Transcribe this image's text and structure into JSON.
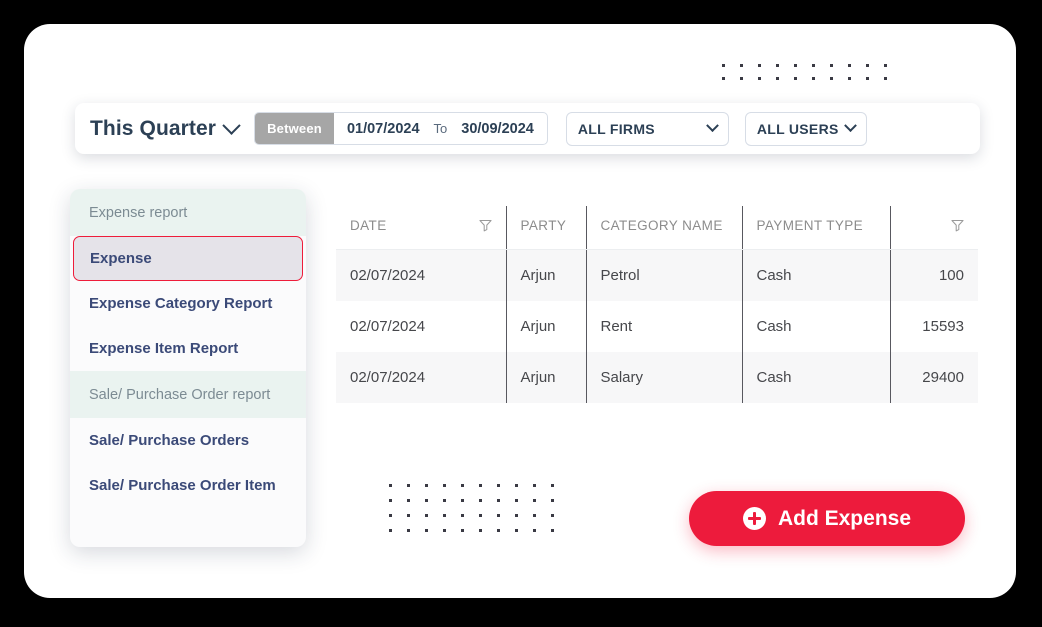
{
  "toolbar": {
    "period_label": "This Quarter",
    "between_badge": "Between",
    "date_from": "01/07/2024",
    "to_label": "To",
    "date_to": "30/09/2024",
    "firms_dropdown": "ALL FIRMS",
    "users_dropdown": "ALL USERS"
  },
  "sidebar": {
    "groups": [
      {
        "section": "Expense report",
        "items": [
          {
            "label": "Expense",
            "active": true
          },
          {
            "label": "Expense Category Report",
            "active": false
          },
          {
            "label": "Expense Item Report",
            "active": false
          }
        ]
      },
      {
        "section": "Sale/ Purchase Order report",
        "items": [
          {
            "label": "Sale/ Purchase Orders",
            "active": false
          },
          {
            "label": "Sale/ Purchase Order Item",
            "active": false
          }
        ]
      }
    ]
  },
  "table": {
    "columns": [
      {
        "label": "DATE",
        "filter": true
      },
      {
        "label": "PARTY",
        "filter": false
      },
      {
        "label": "CATEGORY NAME",
        "filter": false
      },
      {
        "label": "PAYMENT TYPE",
        "filter": false
      },
      {
        "label": "",
        "filter": true
      }
    ],
    "rows": [
      {
        "date": "02/07/2024",
        "party": "Arjun",
        "category": "Petrol",
        "payment_type": "Cash",
        "amount": "100"
      },
      {
        "date": "02/07/2024",
        "party": "Arjun",
        "category": "Rent",
        "payment_type": "Cash",
        "amount": "15593"
      },
      {
        "date": "02/07/2024",
        "party": "Arjun",
        "category": "Salary",
        "payment_type": "Cash",
        "amount": "29400"
      }
    ]
  },
  "actions": {
    "add_expense_label": "Add Expense"
  },
  "colors": {
    "accent_red": "#ed1b3c",
    "section_header_bg": "#eaf3f0",
    "between_badge_bg": "#a6a6a6",
    "text_navy": "#2c4055",
    "page_background": "#000000"
  }
}
